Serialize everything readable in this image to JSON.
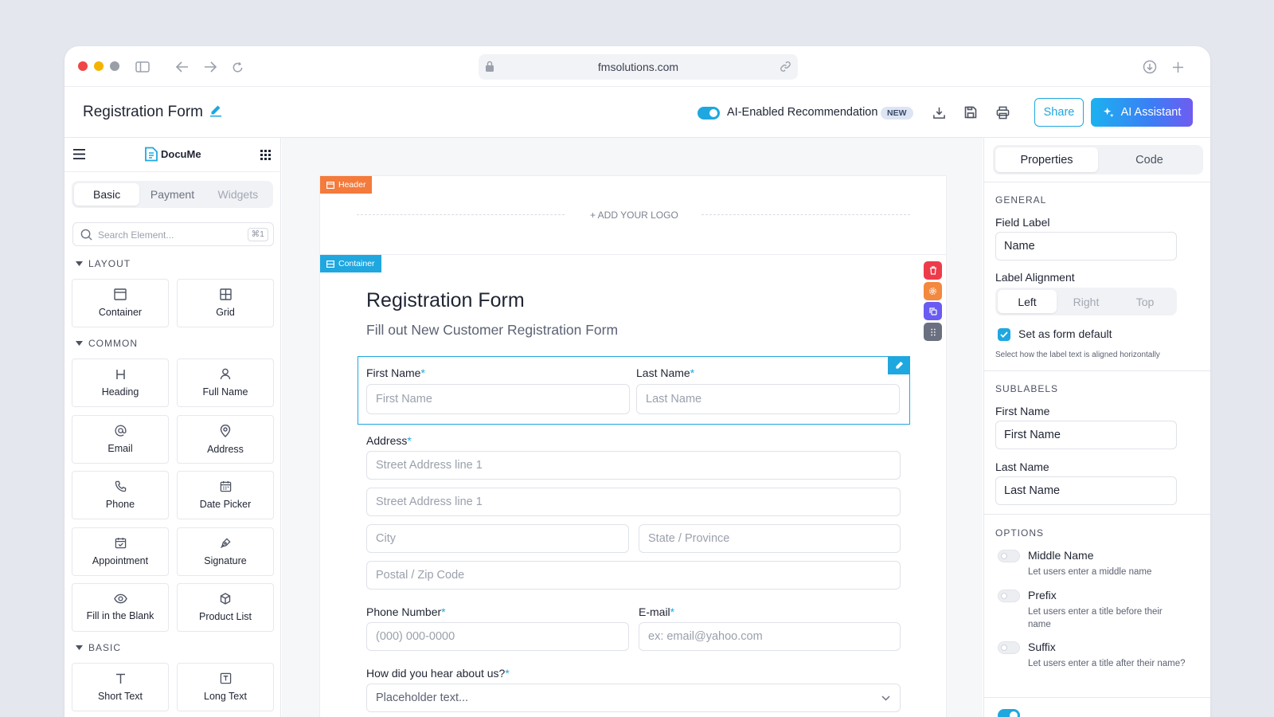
{
  "browser": {
    "url": "fmsolutions.com"
  },
  "app": {
    "title": "Registration Form",
    "ai_toggle_label": "AI-Enabled Recommendation",
    "new_badge": "NEW",
    "share_label": "Share",
    "ai_assistant_label": "AI Assistant"
  },
  "left_panel": {
    "brand": "DocuMe",
    "tabs": [
      "Basic",
      "Payment",
      "Widgets"
    ],
    "search": {
      "placeholder": "Search Element...",
      "shortcut": "⌘1"
    },
    "sections": {
      "layout": {
        "title": "LAYOUT",
        "items": [
          "Container",
          "Grid"
        ]
      },
      "common": {
        "title": "COMMON",
        "items": [
          "Heading",
          "Full Name",
          "Email",
          "Address",
          "Phone",
          "Date Picker",
          "Appointment",
          "Signature",
          "Fill in the Blank",
          "Product List"
        ]
      },
      "basic": {
        "title": "BASIC",
        "items": [
          "Short Text",
          "Long Text"
        ]
      }
    }
  },
  "canvas": {
    "header_tag": "Header",
    "add_logo": "+ ADD YOUR LOGO",
    "container_tag": "Container",
    "form_title": "Registration Form",
    "form_subtitle": "Fill out New Customer Registration Form",
    "fields": {
      "first_name": {
        "label": "First Name",
        "placeholder": "First Name"
      },
      "last_name": {
        "label": "Last Name",
        "placeholder": "Last Name"
      },
      "address": {
        "label": "Address",
        "street1": "Street Address line 1",
        "street2": "Street Address line 1",
        "city": "City",
        "state": "State / Province",
        "postal": "Postal / Zip Code"
      },
      "phone": {
        "label": "Phone Number",
        "placeholder": "(000) 000-0000"
      },
      "email": {
        "label": "E-mail",
        "placeholder": "ex: email@yahoo.com"
      },
      "hear": {
        "label": "How did you hear about us?",
        "placeholder": "Placeholder text..."
      }
    },
    "required_mark": "*"
  },
  "right_panel": {
    "tabs": [
      "Properties",
      "Code"
    ],
    "general": {
      "title": "GENERAL",
      "field_label": "Field Label",
      "field_value": "Name",
      "alignment_label": "Label Alignment",
      "alignment_options": [
        "Left",
        "Right",
        "Top"
      ],
      "default_label": "Set as form default",
      "hint": "Select how the label text is aligned horizontally"
    },
    "sublabels": {
      "title": "SUBLABELS",
      "first_label": "First Name",
      "first_value": "First Name",
      "last_label": "Last Name",
      "last_value": "Last Name"
    },
    "options": {
      "title": "OPTIONS",
      "items": [
        {
          "title": "Middle Name",
          "desc": "Let users enter a middle name"
        },
        {
          "title": "Prefix",
          "desc": "Let users enter a title before their name"
        },
        {
          "title": "Suffix",
          "desc": "Let users enter a title after their name?"
        }
      ]
    }
  },
  "colors": {
    "accent": "#1fa7e0",
    "header_tag": "#f47b3c",
    "delete": "#ee3b4a",
    "settings": "#f3883f",
    "duplicate": "#6a5cf2",
    "drag": "#6b7080"
  }
}
